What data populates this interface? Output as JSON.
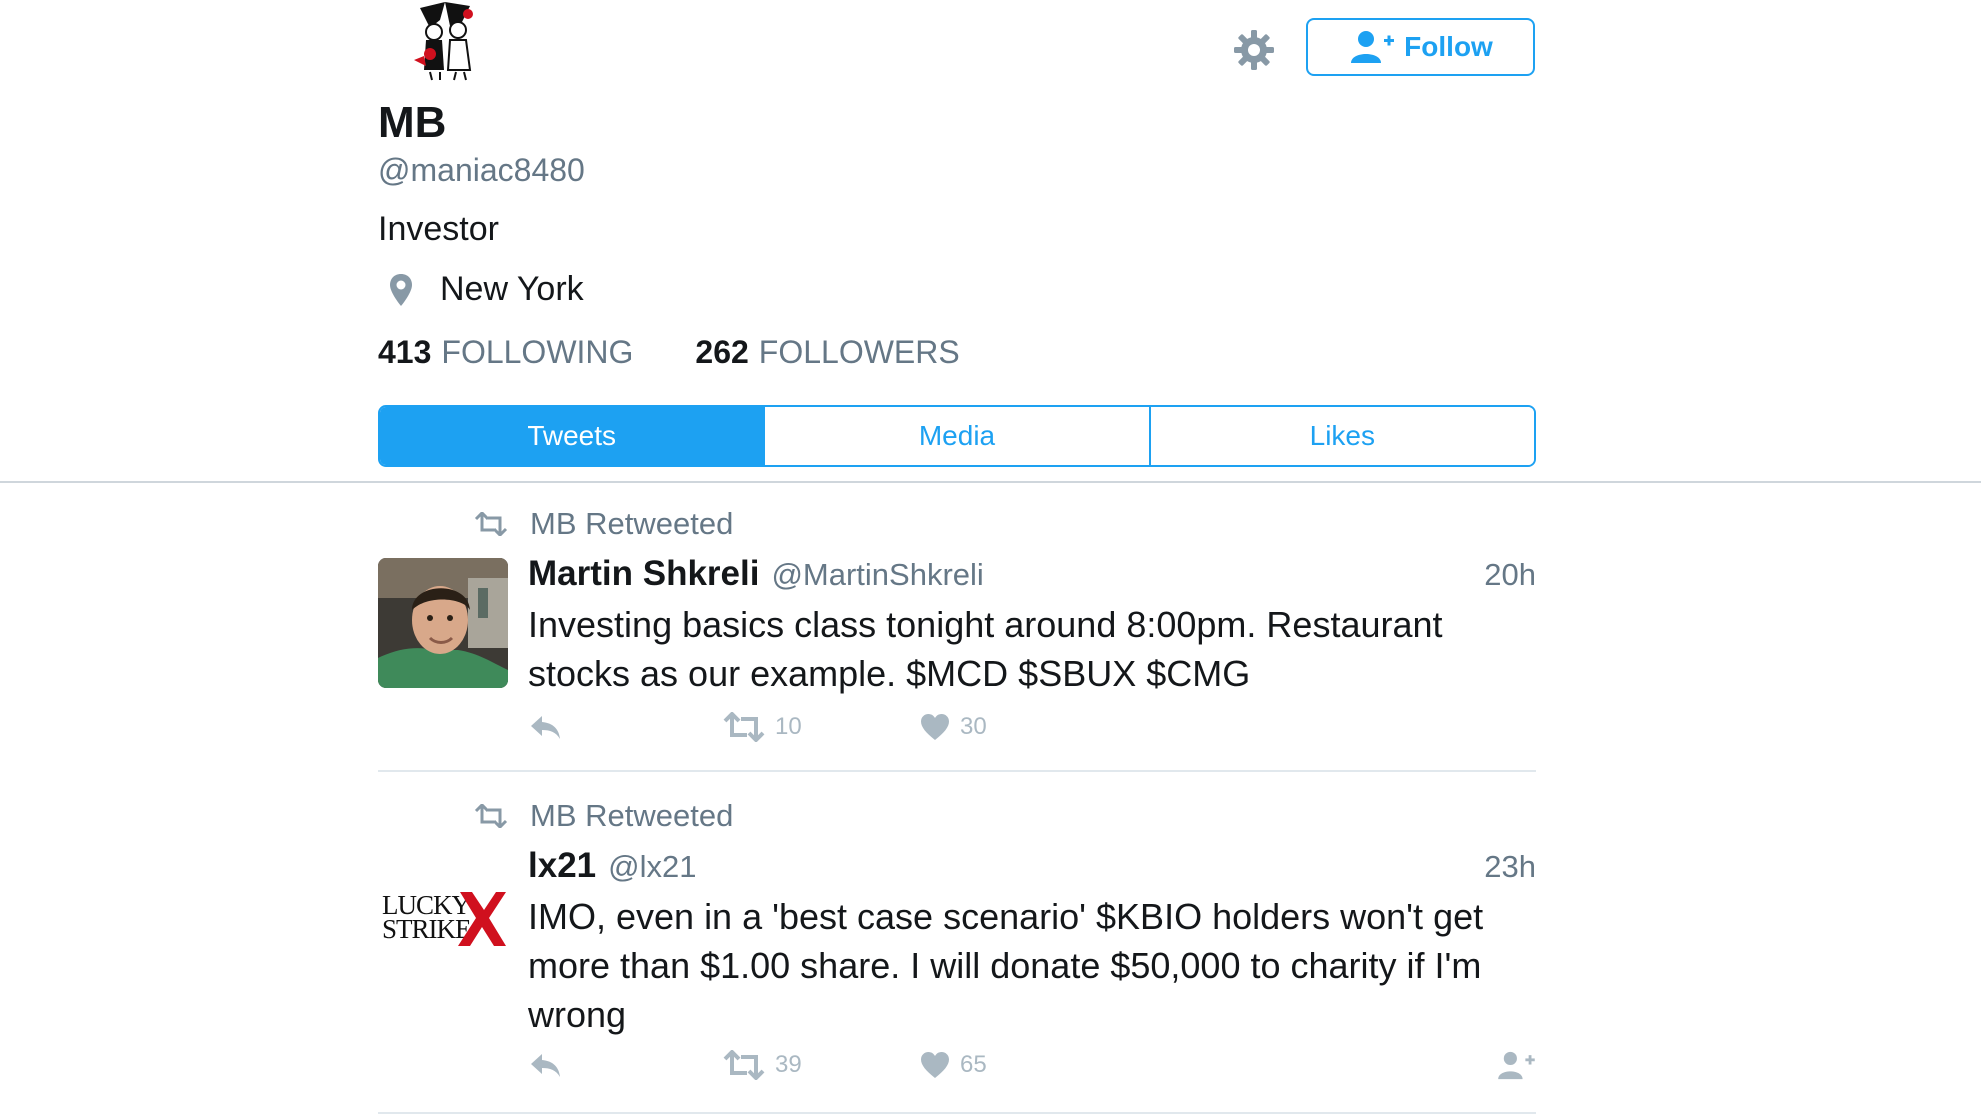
{
  "profile": {
    "name": "MB",
    "handle": "@maniac8480",
    "bio": "Investor",
    "location": "New York",
    "following_count": "413",
    "following_label": "FOLLOWING",
    "followers_count": "262",
    "followers_label": "FOLLOWERS"
  },
  "header": {
    "follow_label": "Follow",
    "settings_icon": "gear-icon"
  },
  "tabs": [
    {
      "label": "Tweets",
      "active": true
    },
    {
      "label": "Media",
      "active": false
    },
    {
      "label": "Likes",
      "active": false
    }
  ],
  "tweets": [
    {
      "retweeted_by": "MB Retweeted",
      "name": "Martin Shkreli",
      "handle": "@MartinShkreli",
      "time": "20h",
      "text": "Investing basics class tonight around 8:00pm. Restaurant stocks as our example. $MCD $SBUX $CMG",
      "retweets": "10",
      "likes": "30"
    },
    {
      "retweeted_by": "MB Retweeted",
      "name": "lx21",
      "handle": "@lx21",
      "time": "23h",
      "text": "IMO, even in a 'best case scenario' $KBIO holders won't get more than $1.00 share. I will donate $50,000 to charity if I'm wrong",
      "avatar_text": "LUCKY STRIKE",
      "retweets": "39",
      "likes": "65"
    }
  ],
  "colors": {
    "accent": "#1da1f2",
    "muted": "#657786",
    "icon_muted": "#aab8c2"
  }
}
